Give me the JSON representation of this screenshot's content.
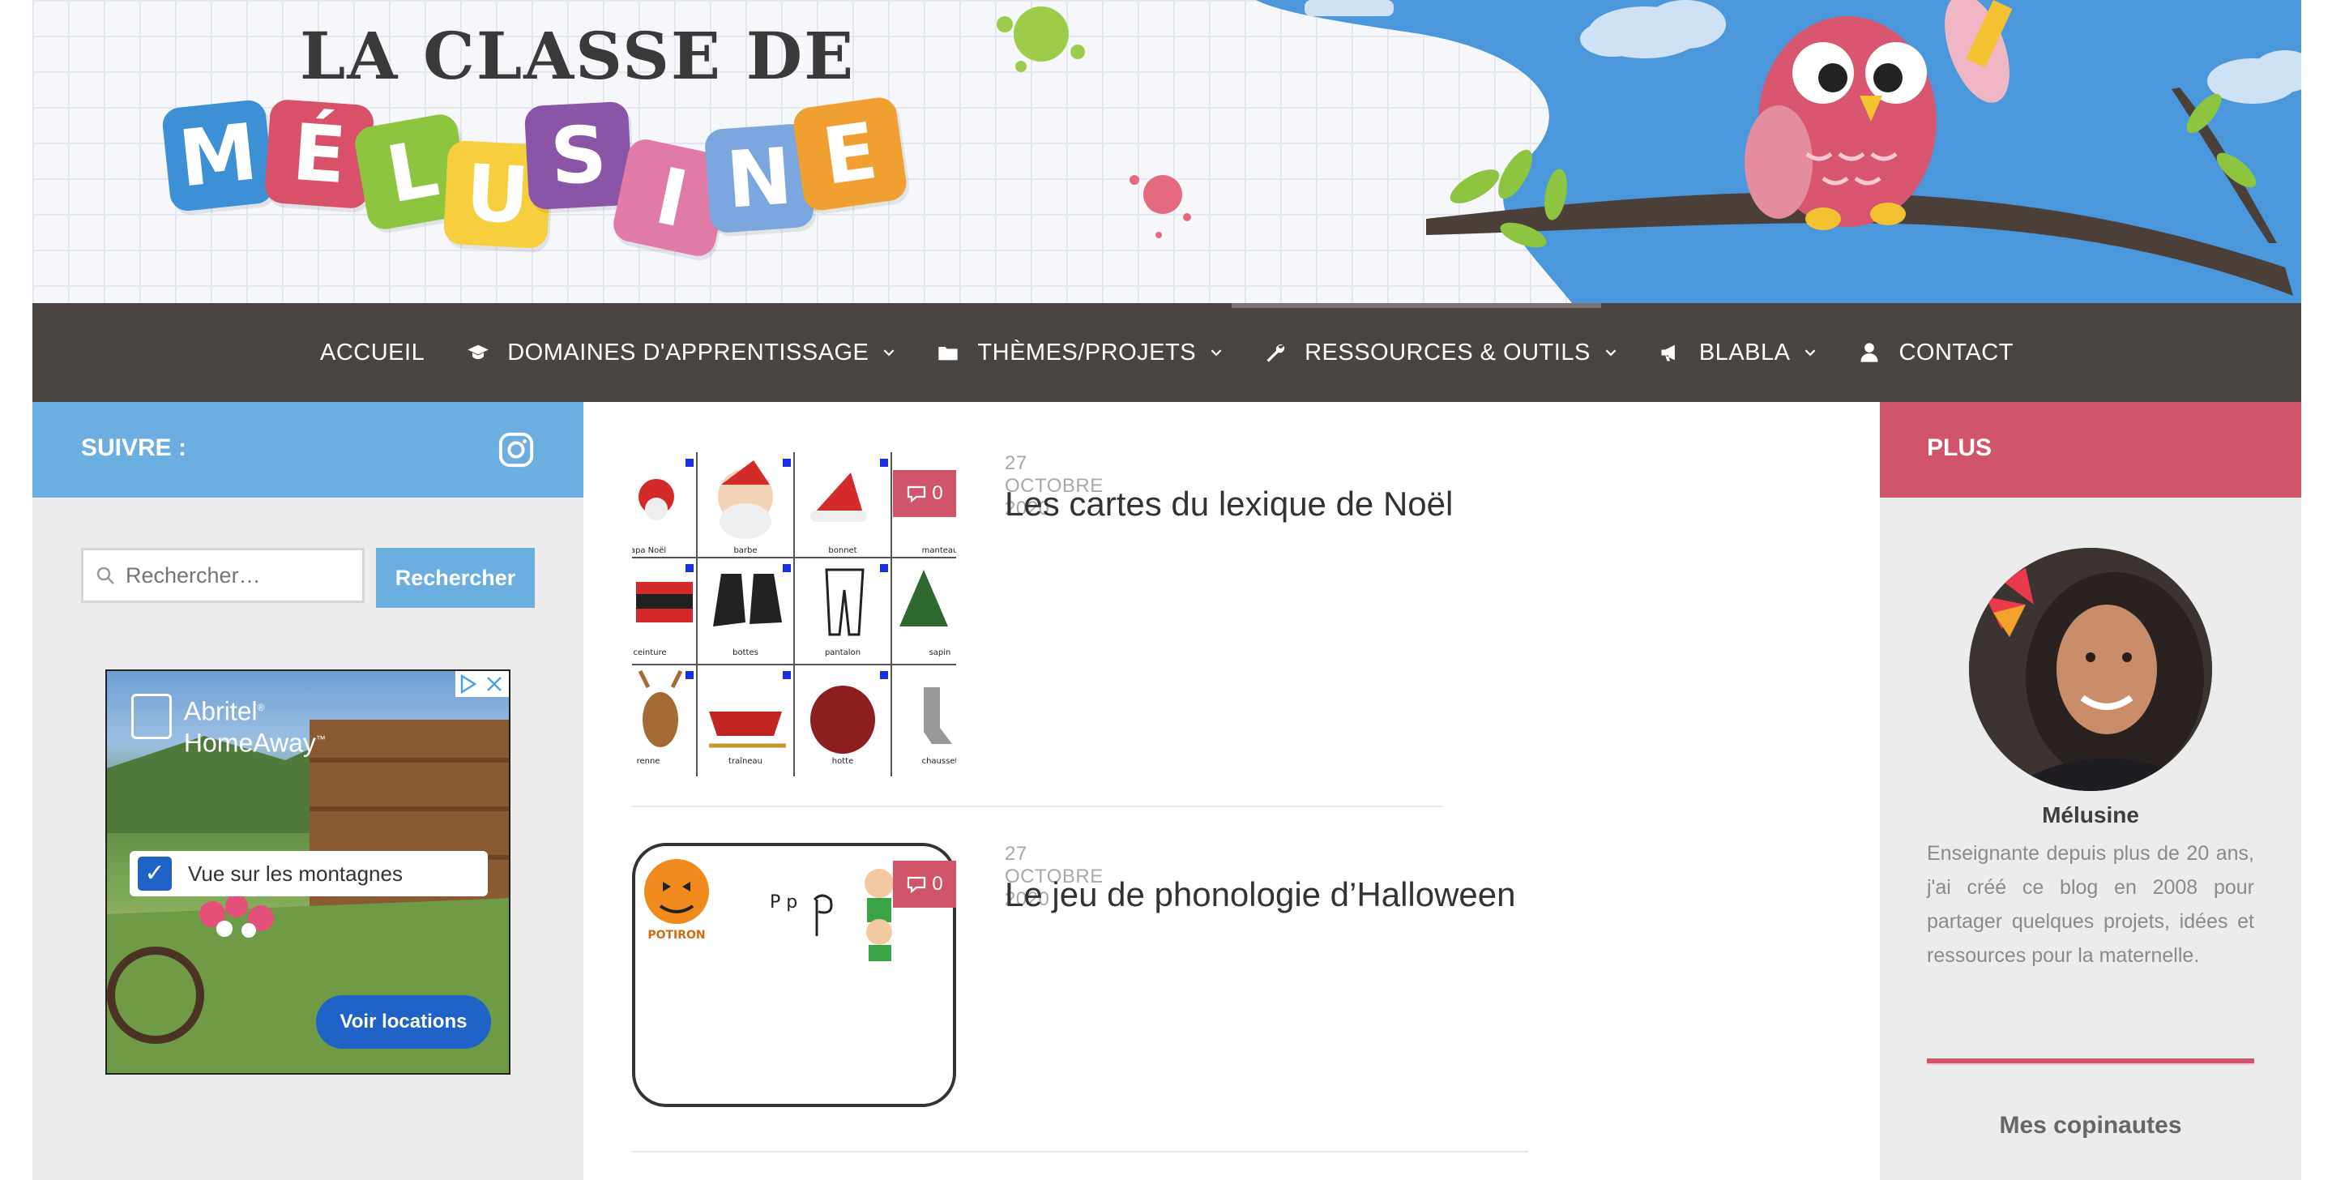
{
  "brand": {
    "logo_top": "LA CLASSE DE",
    "logo_letters": [
      "M",
      "É",
      "L",
      "U",
      "S",
      "I",
      "N",
      "E"
    ]
  },
  "nav": {
    "items": [
      {
        "label": "ACCUEIL",
        "icon": "",
        "has_dropdown": false
      },
      {
        "label": "DOMAINES D'APPRENTISSAGE",
        "icon": "graduation-cap-icon",
        "has_dropdown": true
      },
      {
        "label": "THÈMES/PROJETS",
        "icon": "folder-icon",
        "has_dropdown": true
      },
      {
        "label": "RESSOURCES & OUTILS",
        "icon": "wrench-icon",
        "has_dropdown": true
      },
      {
        "label": "BLABLA",
        "icon": "megaphone-icon",
        "has_dropdown": true
      },
      {
        "label": "CONTACT",
        "icon": "user-icon",
        "has_dropdown": false
      }
    ]
  },
  "left_sidebar": {
    "follow_label": "SUIVRE :",
    "follow_icon": "instagram-icon",
    "search": {
      "placeholder": "Rechercher…",
      "button": "Rechercher"
    },
    "ad": {
      "brand_line1": "Abritel",
      "brand_line2": "HomeAway",
      "checkbox_label": "Vue sur les montagnes",
      "cta": "Voir locations"
    }
  },
  "posts": [
    {
      "date": "27 OCTOBRE 2020",
      "title": "Les cartes du lexique de Noël",
      "comments": "0",
      "thumb_labels": [
        "apa Noël",
        "barbe",
        "bonnet",
        "manteau",
        "ceinture",
        "bottes",
        "pantalon",
        "sapin",
        "renne",
        "traîneau",
        "hotte",
        "chausset"
      ]
    },
    {
      "date": "27 OCTOBRE 2020",
      "title": "Le jeu de phonologie d’Halloween",
      "comments": "0",
      "thumb_labels": [
        "POTIRON",
        "P p"
      ]
    }
  ],
  "right_sidebar": {
    "header": "PLUS",
    "author": "Mélusine",
    "bio": "Enseignante depuis plus de 20 ans, j'ai créé ce blog en 2008 pour partager quelques projets, idées et ressources pour la maternelle.",
    "section_title": "Mes copinautes"
  },
  "colors": {
    "nav_bg": "#4b4541",
    "follow_blue": "#6caee0",
    "accent_pink": "#d1556a",
    "sidebar_bg": "#ececec"
  }
}
